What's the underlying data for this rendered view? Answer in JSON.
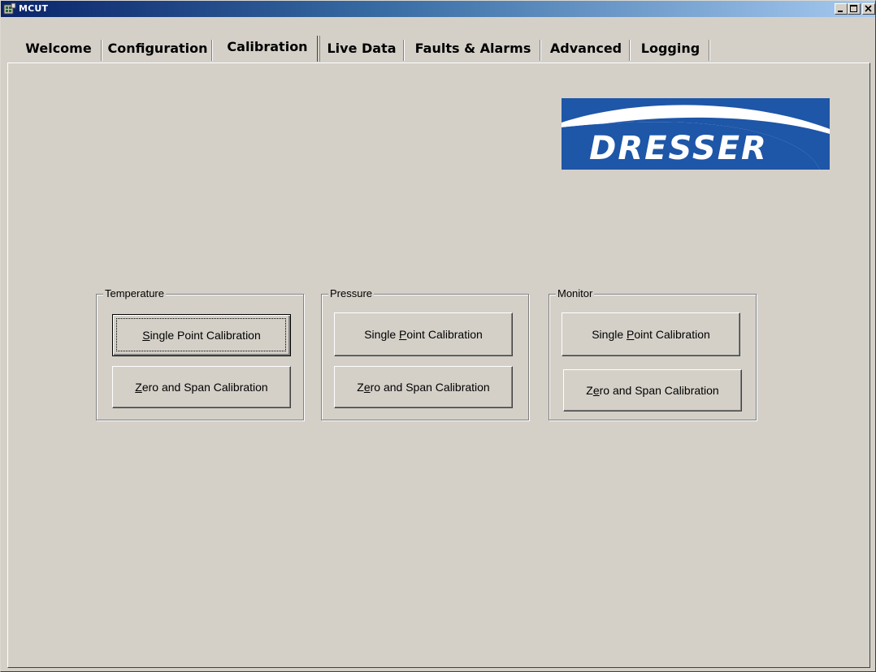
{
  "window": {
    "title": "MCUT",
    "app_icon": "application-icon",
    "controls": [
      "minimize-icon",
      "maximize-icon",
      "close-icon"
    ]
  },
  "tabs": [
    {
      "label": "Welcome",
      "active": false
    },
    {
      "label": "Configuration",
      "active": false
    },
    {
      "label": "Calibration",
      "active": true
    },
    {
      "label": "Live Data",
      "active": false
    },
    {
      "label": "Faults & Alarms",
      "active": false
    },
    {
      "label": "Advanced",
      "active": false
    },
    {
      "label": "Logging",
      "active": false
    }
  ],
  "logo": {
    "text": "DRESSER",
    "color": "#1e56a8"
  },
  "groups": {
    "temperature": {
      "label": "Temperature",
      "single_point": {
        "before": "",
        "key": "S",
        "after": "ingle Point Calibration"
      },
      "zero_span": {
        "before": "",
        "key": "Z",
        "after": "ero and Span Calibration"
      }
    },
    "pressure": {
      "label": "Pressure",
      "single_point": {
        "before": "Single ",
        "key": "P",
        "after": "oint Calibration"
      },
      "zero_span": {
        "before": "Z",
        "key": "e",
        "after": "ro and Span Calibration"
      }
    },
    "monitor": {
      "label": "Monitor",
      "single_point": {
        "before": "Single ",
        "key": "P",
        "after": "oint Calibration"
      },
      "zero_span": {
        "before": "Z",
        "key": "e",
        "after": "ro and Span Calibration"
      }
    }
  },
  "colors": {
    "face": "#d4d0c8",
    "title_start": "#0a246a",
    "title_end": "#a6caf0"
  }
}
